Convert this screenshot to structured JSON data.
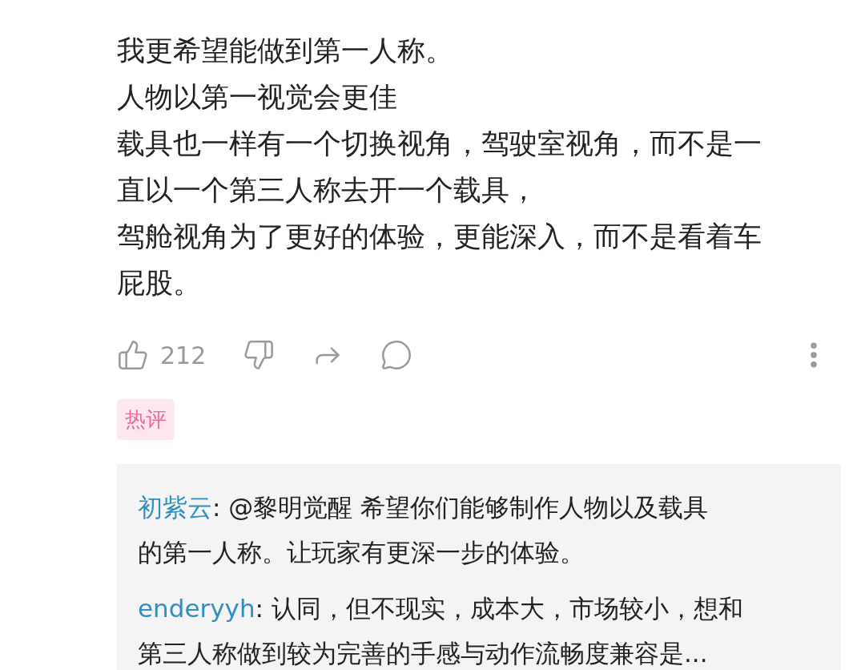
{
  "comment": {
    "lines": [
      "我更希望能做到第一人称。",
      "人物以第一视觉会更佳",
      "载具也一样有一个切换视角，驾驶室视角，而不是一",
      "直以一个第三人称去开一个载具，",
      "驾舱视角为了更好的体验，更能深入，而不是看着车",
      "屁股。"
    ]
  },
  "actions": {
    "like_count": "212"
  },
  "tag": "热评",
  "replies": [
    {
      "user": "初紫云",
      "lines": [
        ": @黎明觉醒 希望你们能够制作人物以及载具",
        "的第一人称。让玩家有更深一步的体验。"
      ]
    },
    {
      "user": "enderyyh",
      "lines": [
        ": 认同，但不现实，成本大，市场较小，想和",
        "第三人称做到较为完善的手感与动作流畅度兼容是..."
      ]
    }
  ]
}
